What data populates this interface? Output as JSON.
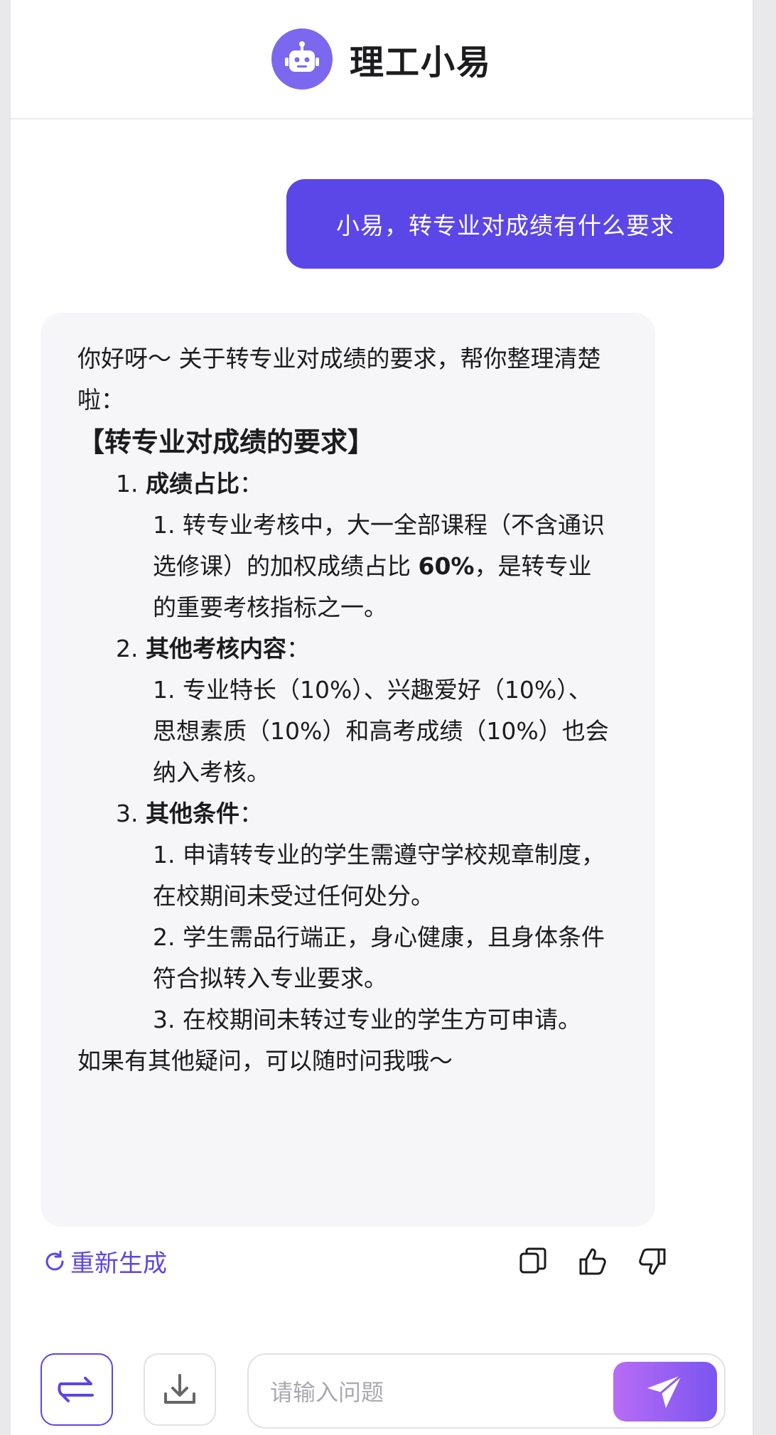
{
  "header": {
    "title": "理工小易",
    "icon": "robot-icon"
  },
  "user_message": {
    "text": "小易，转专业对成绩有什么要求"
  },
  "bot_message": {
    "intro": "你好呀～ 关于转专业对成绩的要求，帮你整理清楚啦：",
    "section_title": "【转专业对成绩的要求】",
    "sections": [
      {
        "num": "1.",
        "title": "成绩占比",
        "colon": "：",
        "items": [
          {
            "num": "1.",
            "pre": "转专业考核中，大一全部课程（不含通识选修课）的加权成绩占比",
            "bold": "60%",
            "post": "，是转专业的重要考核指标之一。"
          }
        ]
      },
      {
        "num": "2.",
        "title": "其他考核内容",
        "colon": "：",
        "items": [
          {
            "num": "1.",
            "text": "专业特长（10%）、兴趣爱好（10%）、思想素质（10%）和高考成绩（10%）也会纳入考核。"
          }
        ]
      },
      {
        "num": "3.",
        "title": "其他条件",
        "colon": "：",
        "items": [
          {
            "num": "1.",
            "text": "申请转专业的学生需遵守学校规章制度，在校期间未受过任何处分。"
          },
          {
            "num": "2.",
            "text": "学生需品行端正，身心健康，且身体条件符合拟转入专业要求。"
          },
          {
            "num": "3.",
            "text": "在校期间未转过专业的学生方可申请。"
          }
        ]
      }
    ],
    "outro": "如果有其他疑问，可以随时问我哦～"
  },
  "actions": {
    "regenerate_label": "重新生成",
    "icons": [
      "refresh-icon",
      "copy-icon",
      "thumbs-up-icon",
      "thumbs-down-icon"
    ]
  },
  "composer": {
    "placeholder": "请输入问题",
    "value": "",
    "icons": [
      "switch-icon",
      "download-icon",
      "send-icon"
    ]
  },
  "colors": {
    "accent": "#5b46e8",
    "avatar": "#7b68ee",
    "bubble_bg": "#f6f6f9",
    "send_gradient_start": "#b86cf5",
    "send_gradient_end": "#7a55f0"
  }
}
